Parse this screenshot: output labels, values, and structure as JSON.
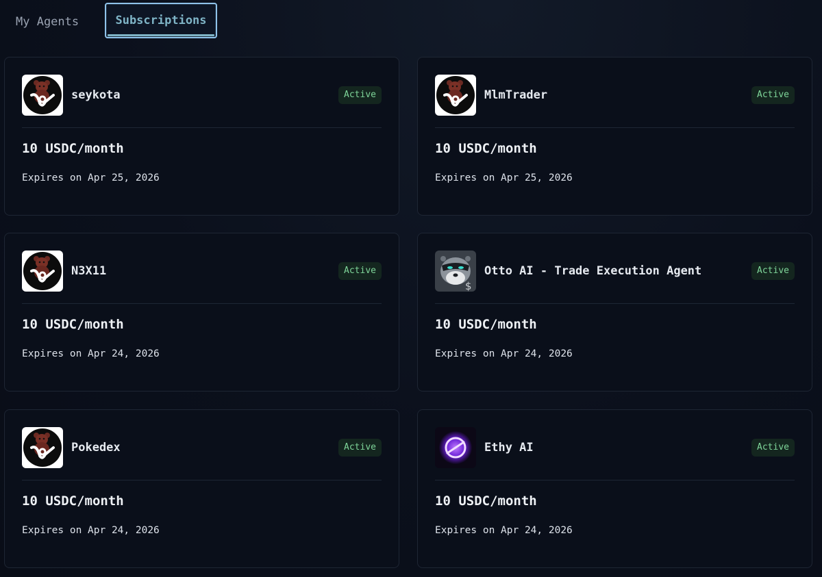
{
  "tabs": {
    "my_agents": "My Agents",
    "subscriptions": "Subscriptions"
  },
  "colors": {
    "accent": "#8fc3ea",
    "badge_text": "#7fd69a",
    "badge_bg": "#14261f"
  },
  "subscriptions": [
    {
      "name": "seykota",
      "status": "Active",
      "price": "10 USDC/month",
      "expires": "Expires on Apr 25, 2026",
      "avatar": "bear-logo"
    },
    {
      "name": "MlmTrader",
      "status": "Active",
      "price": "10 USDC/month",
      "expires": "Expires on Apr 25, 2026",
      "avatar": "bear-logo"
    },
    {
      "name": "N3X11",
      "status": "Active",
      "price": "10 USDC/month",
      "expires": "Expires on Apr 24, 2026",
      "avatar": "bear-logo"
    },
    {
      "name": "Otto AI - Trade Execution Agent",
      "status": "Active",
      "price": "10 USDC/month",
      "expires": "Expires on Apr 24, 2026",
      "avatar": "otter-logo"
    },
    {
      "name": "Pokedex",
      "status": "Active",
      "price": "10 USDC/month",
      "expires": "Expires on Apr 24, 2026",
      "avatar": "bear-logo"
    },
    {
      "name": "Ethy AI",
      "status": "Active",
      "price": "10 USDC/month",
      "expires": "Expires on Apr 24, 2026",
      "avatar": "orb-logo"
    }
  ]
}
